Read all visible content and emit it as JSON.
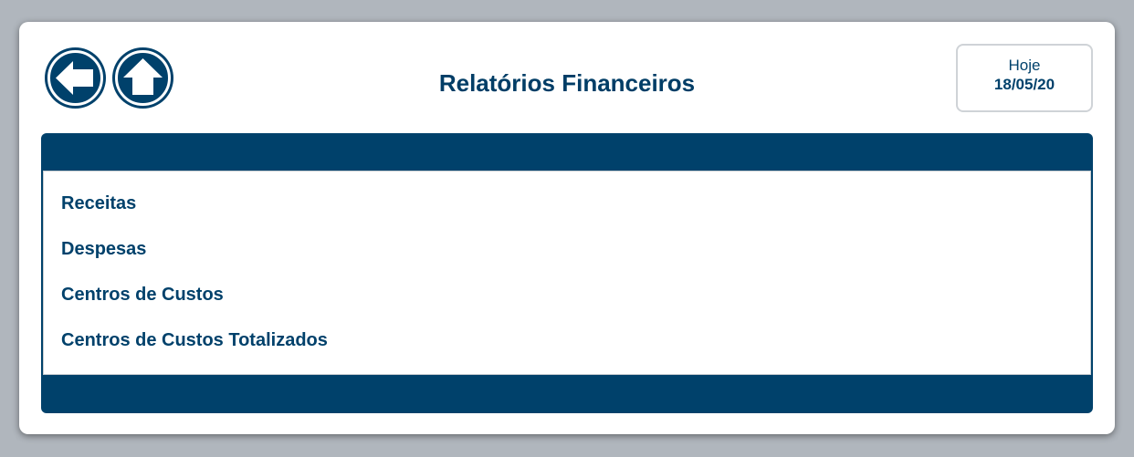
{
  "header": {
    "title": "Relatórios Financeiros",
    "date_label": "Hoje",
    "date_value": "18/05/20",
    "back_icon": "arrow-left-icon",
    "home_icon": "arrow-up-icon"
  },
  "menu": {
    "items": [
      {
        "label": "Receitas"
      },
      {
        "label": "Despesas"
      },
      {
        "label": "Centros de Custos"
      },
      {
        "label": "Centros de Custos Totalizados"
      }
    ]
  },
  "colors": {
    "primary": "#00416b",
    "background": "#b0b6bd",
    "card": "#ffffff"
  }
}
